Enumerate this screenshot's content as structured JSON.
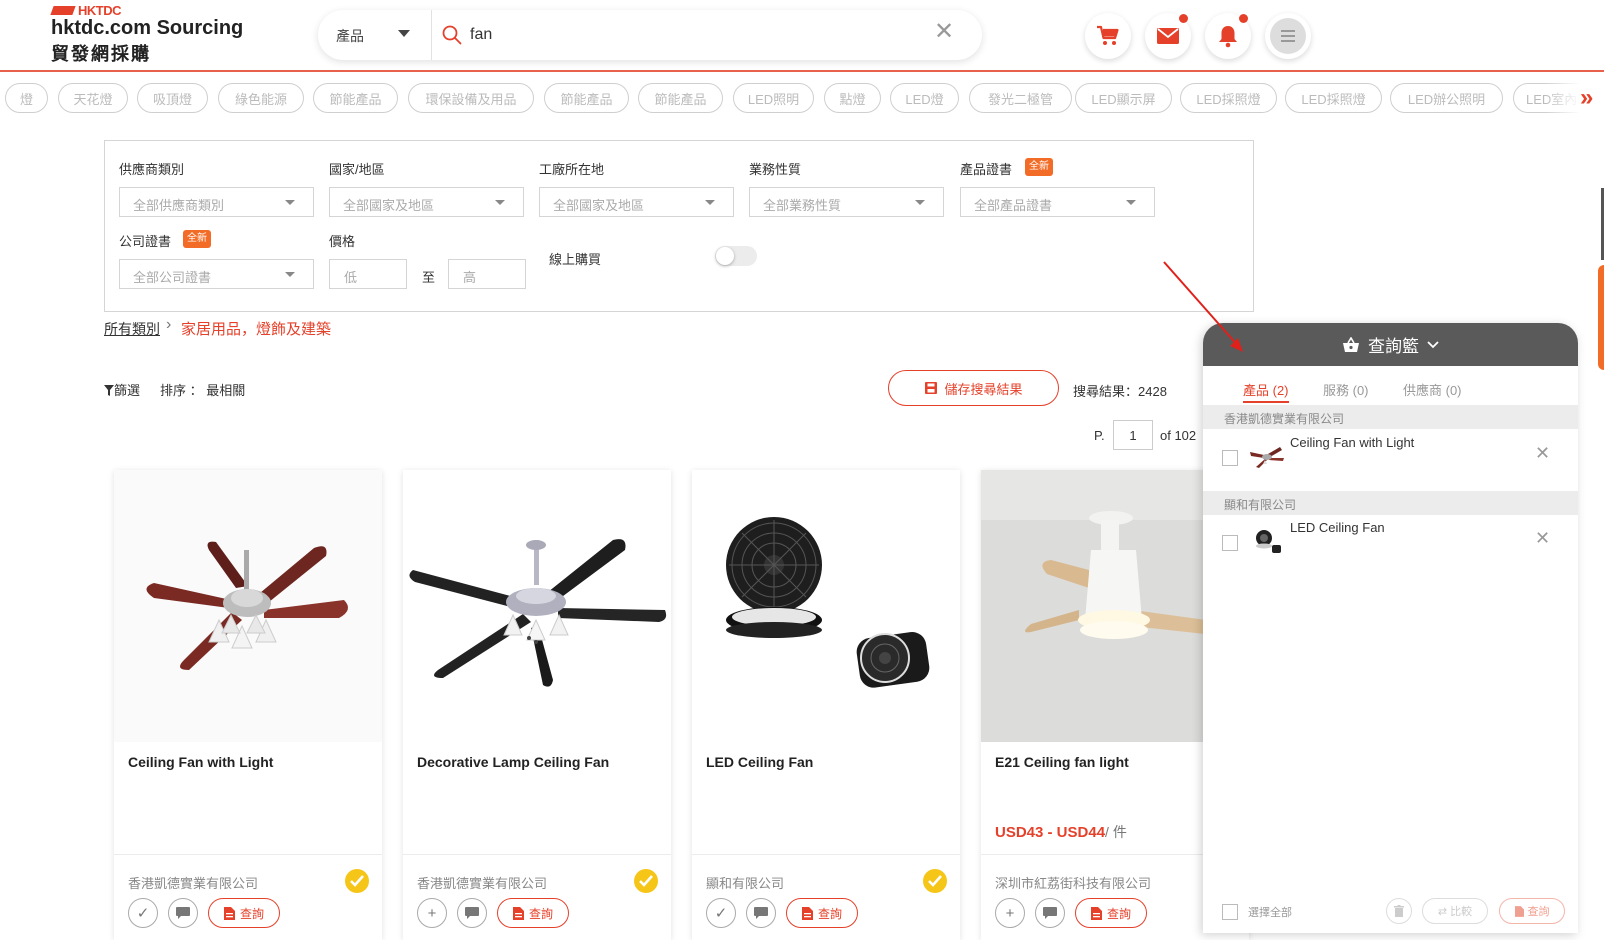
{
  "header": {
    "logo_brand": "HKTDC",
    "logo_title": "hktdc.com Sourcing",
    "logo_subtitle": "貿發網採購",
    "search_category": "產品",
    "search_query": "fan"
  },
  "chips": [
    "燈",
    "天花燈",
    "吸頂燈",
    "綠色能源",
    "節能產品",
    "環保設備及用品",
    "節能產品",
    "節能產品",
    "LED照明",
    "點燈",
    "LED燈",
    "發光二極管",
    "LED顯示屏",
    "LED採照燈",
    "LED採照燈",
    "LED辦公照明",
    "LED室內照"
  ],
  "filters": {
    "supplier_type": {
      "label": "供應商類別",
      "value": "全部供應商類別"
    },
    "country": {
      "label": "國家/地區",
      "value": "全部國家及地區"
    },
    "factory_location": {
      "label": "工廠所在地",
      "value": "全部國家及地區"
    },
    "business_type": {
      "label": "業務性質",
      "value": "全部業務性質"
    },
    "product_cert": {
      "label": "產品證書",
      "value": "全部產品證書",
      "tag": "全新"
    },
    "company_cert": {
      "label": "公司證書",
      "value": "全部公司證書",
      "tag": "全新"
    },
    "price": {
      "label": "價格",
      "low": "低",
      "to": "至",
      "high": "高"
    },
    "online_purchase": {
      "label": "線上購買",
      "enabled": false
    }
  },
  "breadcrumb": {
    "all": "所有類別",
    "current": "家居用品，燈飾及建築"
  },
  "toolbar": {
    "filter": "篩選",
    "sort": "排序 ： 最相關",
    "save_search": "儲存搜尋結果",
    "results": "搜尋結果：2428",
    "page_prefix": "P.",
    "page_current": "1",
    "page_total": "of 102"
  },
  "products": [
    {
      "title": "Ceiling Fan with Light",
      "price": "",
      "unit": "",
      "supplier": "香港凱德實業有限公司",
      "verified": true,
      "added": true,
      "enquiry": "查詢"
    },
    {
      "title": "Decorative Lamp Ceiling Fan",
      "price": "",
      "unit": "",
      "supplier": "香港凱德實業有限公司",
      "verified": true,
      "added": false,
      "enquiry": "查詢"
    },
    {
      "title": "LED Ceiling Fan",
      "price": "",
      "unit": "",
      "supplier": "顯和有限公司",
      "verified": true,
      "added": true,
      "enquiry": "查詢"
    },
    {
      "title": "E21 Ceiling fan light",
      "price": "USD43 - USD44",
      "unit": "/ 件",
      "supplier": "深圳市紅荔街科技有限公司",
      "verified": false,
      "added": false,
      "enquiry": "查詢"
    }
  ],
  "basket": {
    "title": "查詢籃",
    "tabs": [
      {
        "label": "產品 (2)",
        "active": true
      },
      {
        "label": "服務 (0)",
        "active": false
      },
      {
        "label": "供應商 (0)",
        "active": false
      }
    ],
    "groups": [
      {
        "supplier": "香港凱德實業有限公司",
        "item": "Ceiling Fan with Light"
      },
      {
        "supplier": "顯和有限公司",
        "item": "LED Ceiling Fan"
      }
    ],
    "select_all": "選擇全部",
    "compare": "比較",
    "enquiry": "查詢"
  },
  "colors": {
    "accent": "#e5412a",
    "basket_header": "#5a5a5a",
    "verified": "#f5c518"
  }
}
